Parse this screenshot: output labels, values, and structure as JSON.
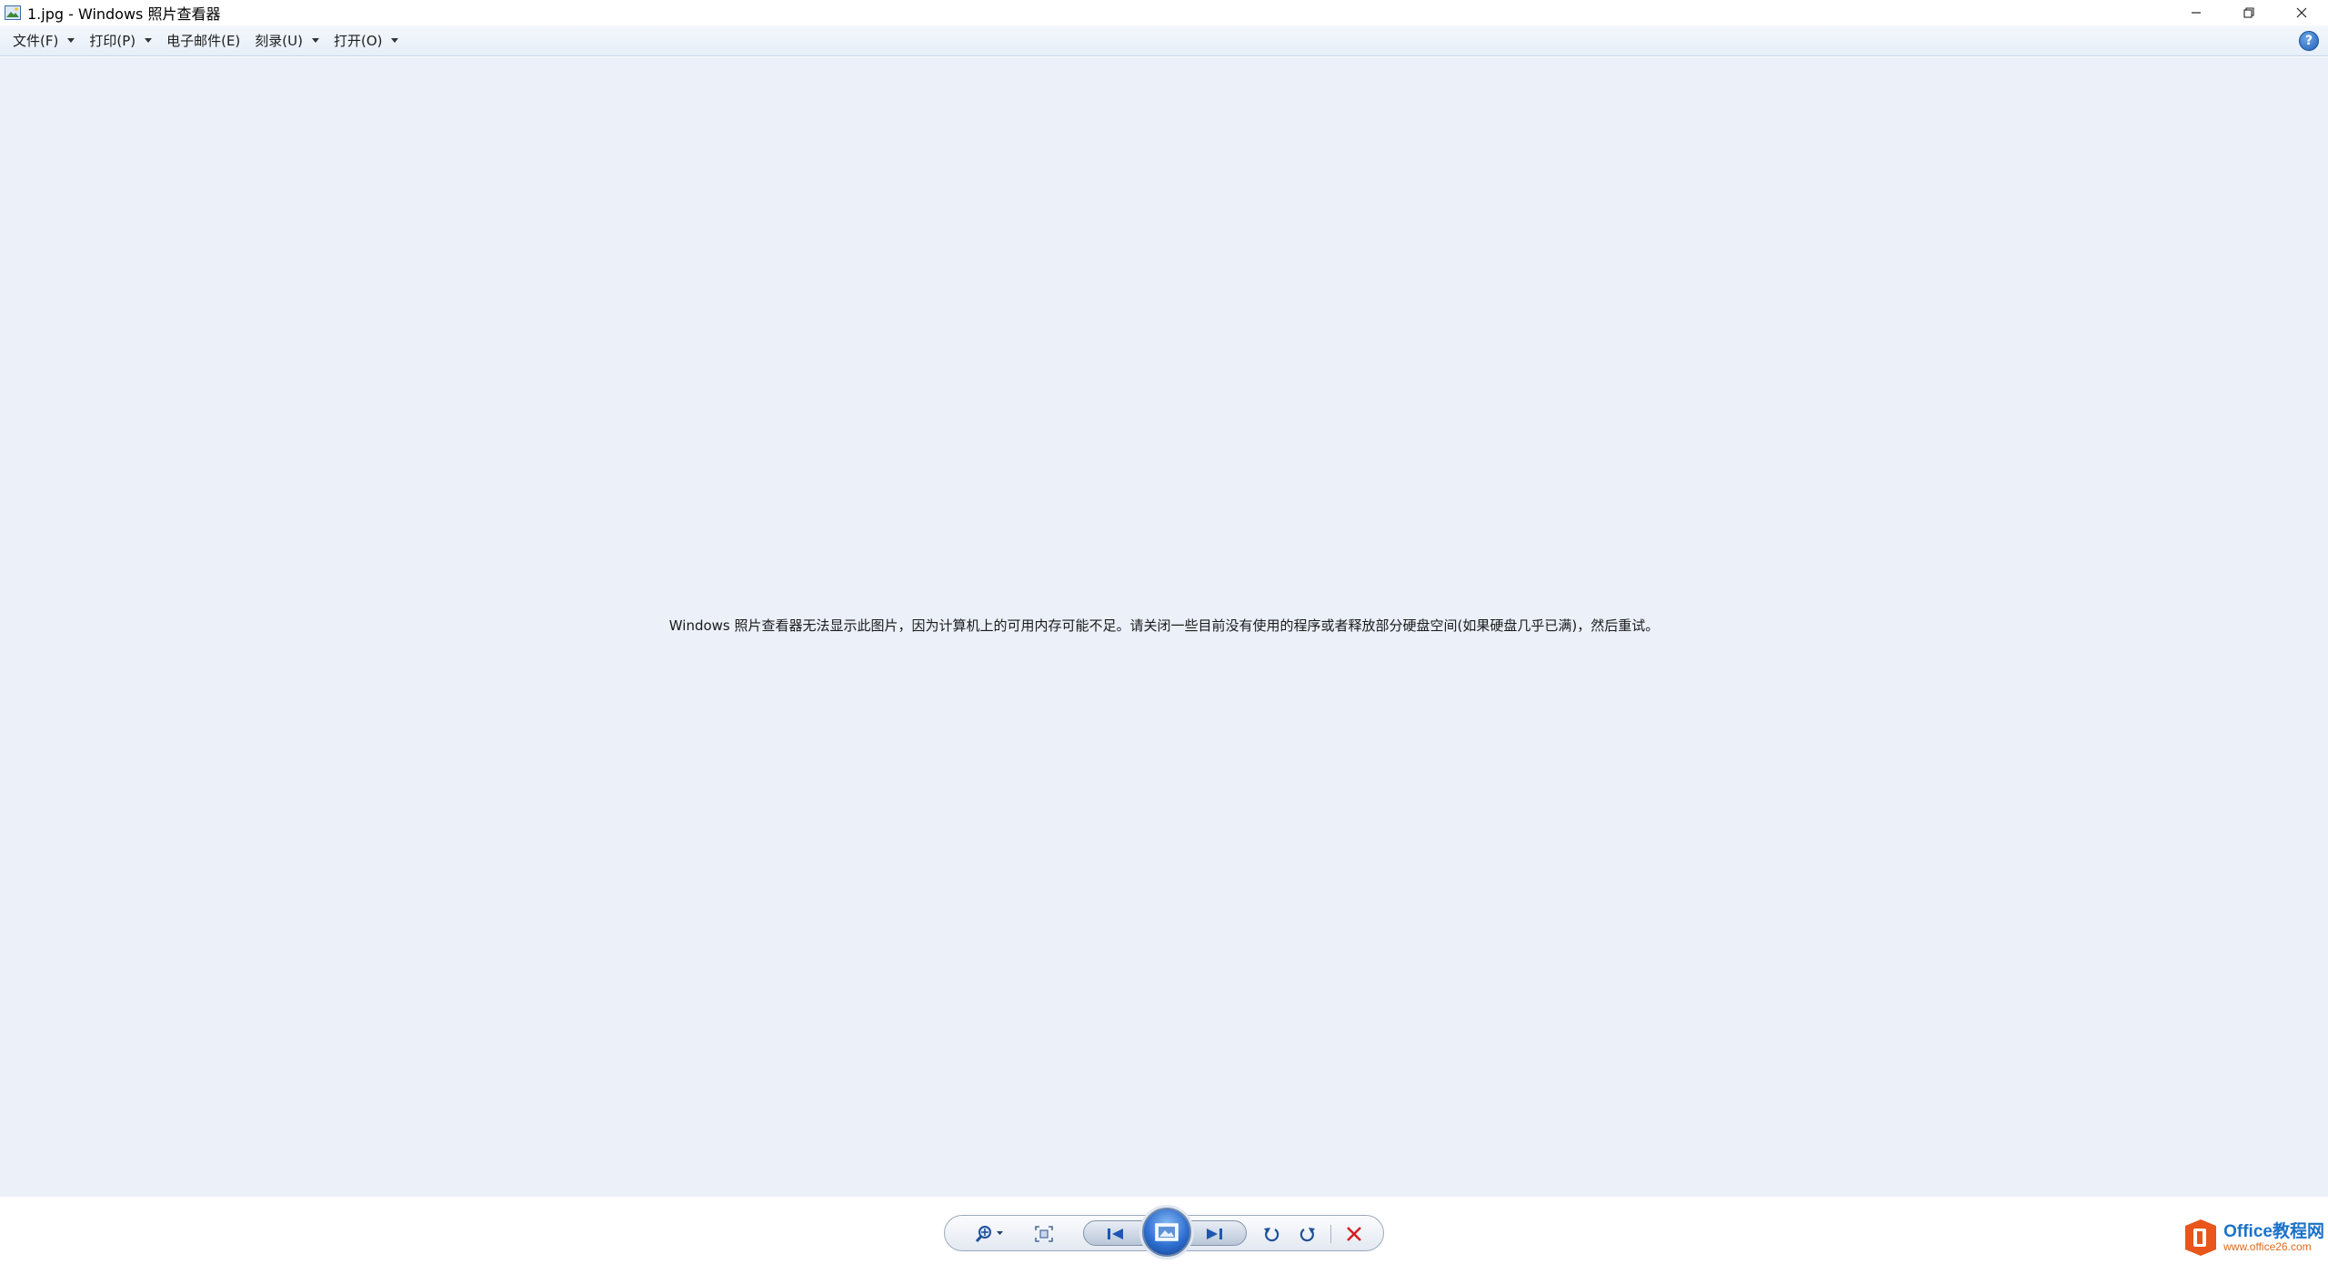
{
  "window": {
    "title": "1.jpg - Windows 照片查看器",
    "controls": {
      "minimize_icon": "minimize-icon",
      "restore_icon": "restore-icon",
      "close_icon": "close-icon"
    }
  },
  "menu": {
    "items": [
      {
        "label": "文件(F)",
        "has_dropdown": true
      },
      {
        "label": "打印(P)",
        "has_dropdown": true
      },
      {
        "label": "电子邮件(E)",
        "has_dropdown": false
      },
      {
        "label": "刻录(U)",
        "has_dropdown": true
      },
      {
        "label": "打开(O)",
        "has_dropdown": true
      }
    ],
    "help_label": "?"
  },
  "viewer": {
    "background": "#ebf0f9",
    "message": "Windows 照片查看器无法显示此图片，因为计算机上的可用内存可能不足。请关闭一些目前没有使用的程序或者释放部分硬盘空间(如果硬盘几乎已满)，然后重试。"
  },
  "toolbar": {
    "buttons": [
      "zoom-icon",
      "actual-size-icon",
      "previous-icon",
      "slideshow-icon",
      "next-icon",
      "rotate-ccw-icon",
      "rotate-cw-icon",
      "delete-icon"
    ],
    "accent": "#2e6fd0",
    "delete_color": "#d32020"
  },
  "watermark": {
    "brand": "Office",
    "brand_cn": "教程网",
    "url": "www.office26.com"
  }
}
